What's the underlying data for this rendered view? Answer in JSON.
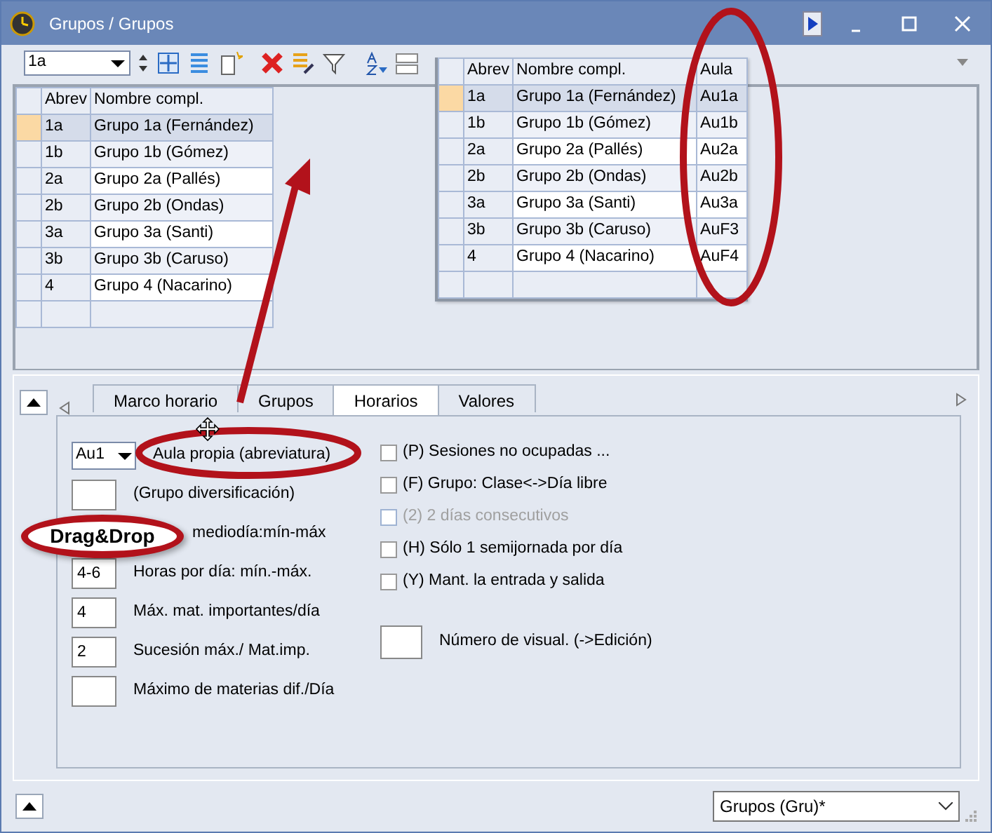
{
  "window": {
    "title": "Grupos / Grupos"
  },
  "toolbar": {
    "record_combo": "1a"
  },
  "grid": {
    "columns": [
      "Abrev",
      "Nombre compl."
    ],
    "rows": [
      {
        "cells": [
          "1a",
          "Grupo 1a (Fernández)"
        ],
        "selected": true
      },
      {
        "cells": [
          "1b",
          "Grupo 1b (Gómez)"
        ],
        "selected": false
      },
      {
        "cells": [
          "2a",
          "Grupo 2a (Pallés)"
        ],
        "selected": false
      },
      {
        "cells": [
          "2b",
          "Grupo 2b (Ondas)"
        ],
        "selected": false
      },
      {
        "cells": [
          "3a",
          "Grupo 3a (Santi)"
        ],
        "selected": false
      },
      {
        "cells": [
          "3b",
          "Grupo 3b (Caruso)"
        ],
        "selected": false
      },
      {
        "cells": [
          "4",
          "Grupo 4 (Nacarino)"
        ],
        "selected": false
      }
    ]
  },
  "dragged_grid": {
    "columns": [
      "Abrev",
      "Nombre compl.",
      "Aula"
    ],
    "rows": [
      {
        "cells": [
          "1a",
          "Grupo 1a (Fernández)",
          "Au1a"
        ],
        "selected": true
      },
      {
        "cells": [
          "1b",
          "Grupo 1b (Gómez)",
          "Au1b"
        ],
        "selected": false
      },
      {
        "cells": [
          "2a",
          "Grupo 2a (Pallés)",
          "Au2a"
        ],
        "selected": false
      },
      {
        "cells": [
          "2b",
          "Grupo 2b (Ondas)",
          "Au2b"
        ],
        "selected": false
      },
      {
        "cells": [
          "3a",
          "Grupo 3a (Santi)",
          "Au3a"
        ],
        "selected": false
      },
      {
        "cells": [
          "3b",
          "Grupo 3b (Caruso)",
          "AuF3"
        ],
        "selected": false
      },
      {
        "cells": [
          "4",
          "Grupo 4 (Nacarino)",
          "AuF4"
        ],
        "selected": false
      }
    ]
  },
  "tabs": [
    {
      "label": "Marco horario",
      "selected": false
    },
    {
      "label": "Grupos",
      "selected": false
    },
    {
      "label": "Horarios",
      "selected": true
    },
    {
      "label": "Valores",
      "selected": false
    }
  ],
  "left_fields": [
    {
      "kind": "combo",
      "value": "Au1",
      "label": "Aula propia (abreviatura)"
    },
    {
      "kind": "field",
      "label": "(Grupo diversificación)"
    },
    {
      "kind": "text",
      "label": "mediodía:mín-máx"
    },
    {
      "kind": "field",
      "value": "4-6",
      "label": "Horas por día: mín.-máx."
    },
    {
      "kind": "field",
      "value": "4",
      "label": "Máx. mat. importantes/día"
    },
    {
      "kind": "field",
      "value": "2",
      "label": "Sucesión máx./ Mat.imp."
    },
    {
      "kind": "field",
      "label": "Máximo de materias dif./Día"
    }
  ],
  "checkboxes": [
    {
      "label": "(P) Sesiones no ocupadas ...",
      "checked": false,
      "disabled": false
    },
    {
      "label": "(F) Grupo: Clase<->Día libre",
      "checked": false,
      "disabled": false
    },
    {
      "label": "(2) 2 días consecutivos",
      "checked": false,
      "disabled": true
    },
    {
      "label": "(H) Sólo 1 semijornada por día",
      "checked": false,
      "disabled": false
    },
    {
      "label": "(Y) Mant. la entrada y salida",
      "checked": false,
      "disabled": false
    }
  ],
  "display_number": {
    "label": "Número de visual. (->Edición)"
  },
  "annotation": {
    "callout": "Drag&Drop"
  },
  "footer": {
    "view_select": "Grupos (Gru)*"
  }
}
